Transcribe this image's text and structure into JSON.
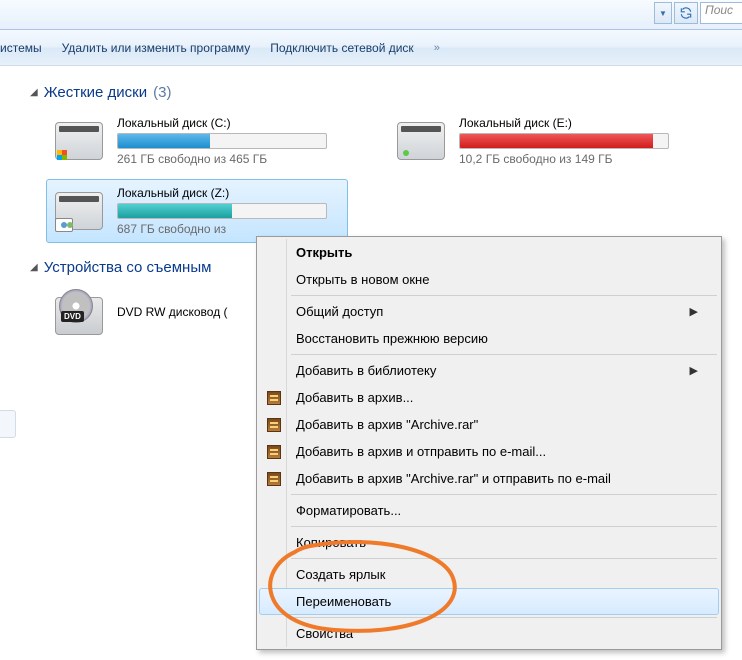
{
  "topbar": {
    "search_placeholder": "Поис"
  },
  "menubar": {
    "item_systems": "истемы",
    "item_uninstall": "Удалить или изменить программу",
    "item_network_drive": "Подключить сетевой диск",
    "chevrons": "»"
  },
  "groups": {
    "hdd": {
      "title": "Жесткие диски",
      "count": "(3)"
    },
    "removable": {
      "title": "Устройства со съемным"
    }
  },
  "drives": {
    "c": {
      "name": "Локальный диск (C:)",
      "sub": "261 ГБ свободно из 465 ГБ",
      "fill_pct": 44,
      "fill_class": "blue"
    },
    "e": {
      "name": "Локальный диск (E:)",
      "sub": "10,2 ГБ свободно из 149 ГБ",
      "fill_pct": 93,
      "fill_class": "red"
    },
    "z": {
      "name": "Локальный диск (Z:)",
      "sub": "687 ГБ свободно из",
      "fill_pct": 55,
      "fill_class": "teal"
    },
    "dvd": {
      "name": "DVD RW дисковод ("
    }
  },
  "context_menu": {
    "open": "Открыть",
    "open_new_window": "Открыть в новом окне",
    "sharing": "Общий доступ",
    "restore_prev": "Восстановить прежнюю версию",
    "add_library": "Добавить в библиотеку",
    "add_archive": "Добавить в архив...",
    "add_archive_rar": "Добавить в архив \"Archive.rar\"",
    "add_archive_email": "Добавить в архив и отправить по e-mail...",
    "add_archive_rar_email": "Добавить в архив \"Archive.rar\" и отправить по e-mail",
    "format": "Форматировать...",
    "copy": "Копировать",
    "create_shortcut": "Создать ярлык",
    "rename": "Переименовать",
    "properties": "Свойства"
  }
}
